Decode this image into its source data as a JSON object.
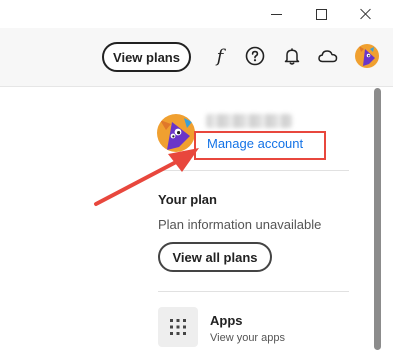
{
  "window": {
    "controls": [
      {
        "name": "minimize",
        "icon": "minimize-icon"
      },
      {
        "name": "maximize",
        "icon": "maximize-icon"
      },
      {
        "name": "close",
        "icon": "close-icon"
      }
    ]
  },
  "header": {
    "view_plans_label": "View plans",
    "font_icon_glyph": "f",
    "icons": [
      "fonts-icon",
      "help-icon",
      "bell-icon",
      "cloud-icon",
      "avatar"
    ]
  },
  "account": {
    "manage_account_label": "Manage account"
  },
  "plan": {
    "title": "Your plan",
    "info": "Plan information unavailable",
    "view_all_label": "View all plans"
  },
  "apps": {
    "title": "Apps",
    "subtitle": "View your apps",
    "icon": "grid-icon"
  },
  "colors": {
    "accent_link": "#1473e6",
    "highlight": "#e8473d",
    "avatar_bg": "#f0a030",
    "avatar_figure": "#6a35c9"
  }
}
